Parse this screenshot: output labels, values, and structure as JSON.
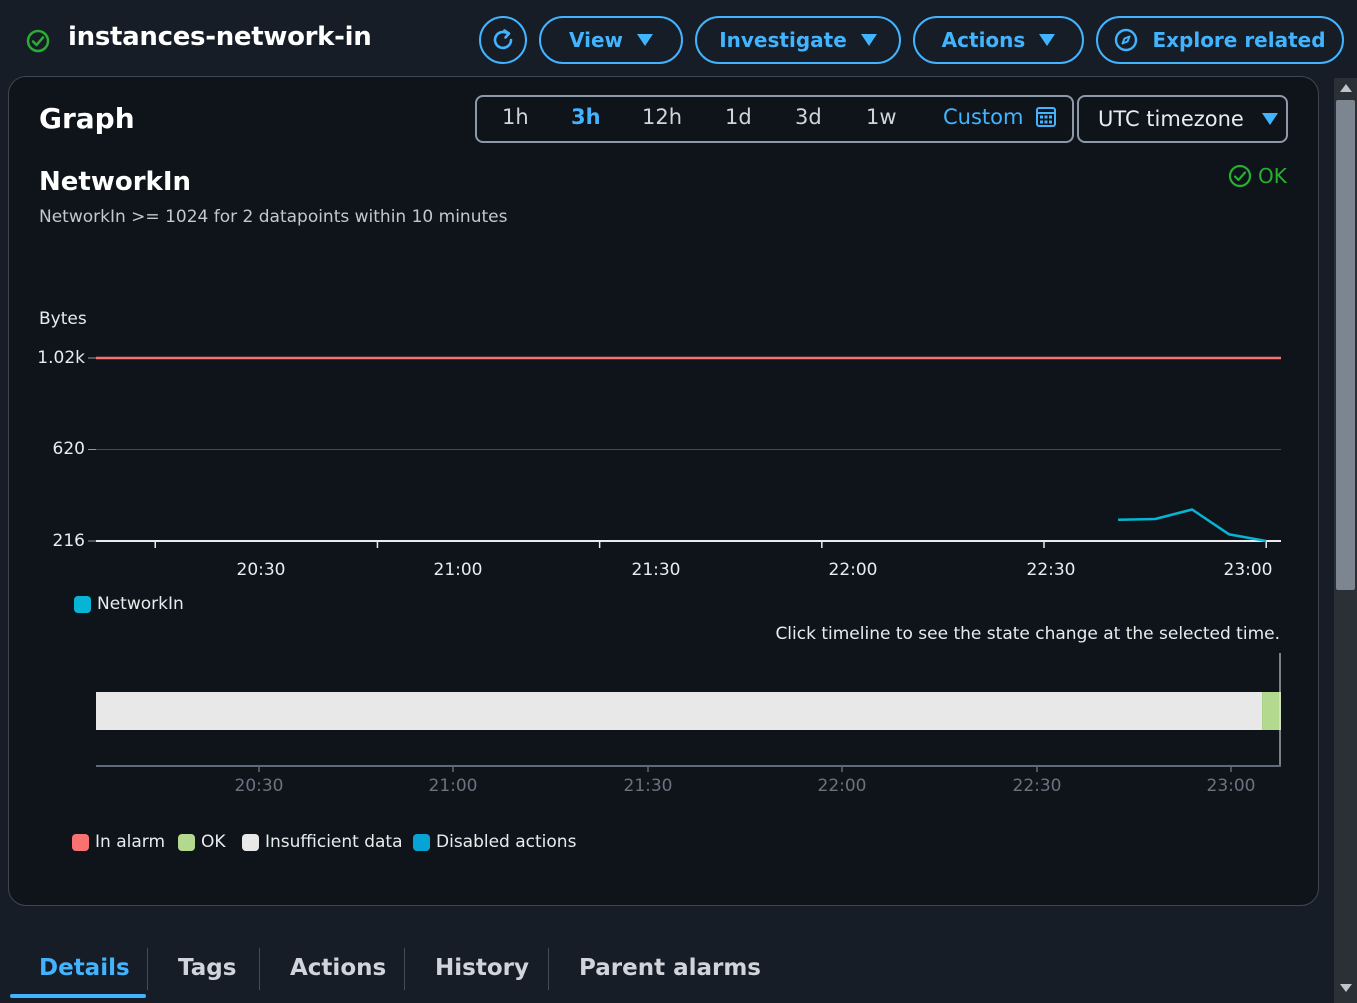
{
  "header": {
    "title": "instances-network-in",
    "buttons": {
      "view": "View",
      "investigate": "Investigate",
      "actions": "Actions",
      "explore": "Explore related"
    }
  },
  "graph": {
    "panel_title": "Graph",
    "ranges": [
      "1h",
      "3h",
      "12h",
      "1d",
      "3d",
      "1w"
    ],
    "active_range": "3h",
    "custom_label": "Custom",
    "timezone": "UTC timezone",
    "metric_title": "NetworkIn",
    "metric_desc": "NetworkIn >= 1024 for 2 datapoints within 10 minutes",
    "status": "OK",
    "hint": "Click timeline to see the state change at the selected time."
  },
  "chart_data": {
    "type": "line",
    "ylabel": "Bytes",
    "y_ticks": [
      "1.02k",
      "620",
      "216"
    ],
    "y_tick_values": [
      1024,
      620,
      216
    ],
    "ylim": [
      216,
      1024
    ],
    "x_ticks": [
      "20:30",
      "21:00",
      "21:30",
      "22:00",
      "22:30",
      "23:00"
    ],
    "threshold": 1024,
    "series": [
      {
        "name": "NetworkIn",
        "color": "#06b5d4",
        "x": [
          "22:40",
          "22:45",
          "22:50",
          "22:55",
          "23:00"
        ],
        "values": [
          310,
          313,
          355,
          245,
          216
        ]
      }
    ],
    "threshold_color": "#f87272",
    "legend": [
      {
        "label": "NetworkIn",
        "color": "#06b5d4"
      }
    ]
  },
  "timeline": {
    "x_ticks": [
      "20:30",
      "21:00",
      "21:30",
      "22:00",
      "22:30",
      "23:00"
    ],
    "insufficient_fraction": 0.984,
    "ok_fraction": 0.016,
    "legend": [
      {
        "label": "In alarm",
        "color": "#f87272"
      },
      {
        "label": "OK",
        "color": "#b3d98f"
      },
      {
        "label": "Insufficient data",
        "color": "#e8e8e8"
      },
      {
        "label": "Disabled actions",
        "color": "#06a4d4"
      }
    ]
  },
  "tabs": [
    "Details",
    "Tags",
    "Actions",
    "History",
    "Parent alarms"
  ],
  "active_tab": "Details",
  "colors": {
    "accent": "#42b4ff",
    "ok": "#29ad32",
    "background": "#161d26"
  }
}
